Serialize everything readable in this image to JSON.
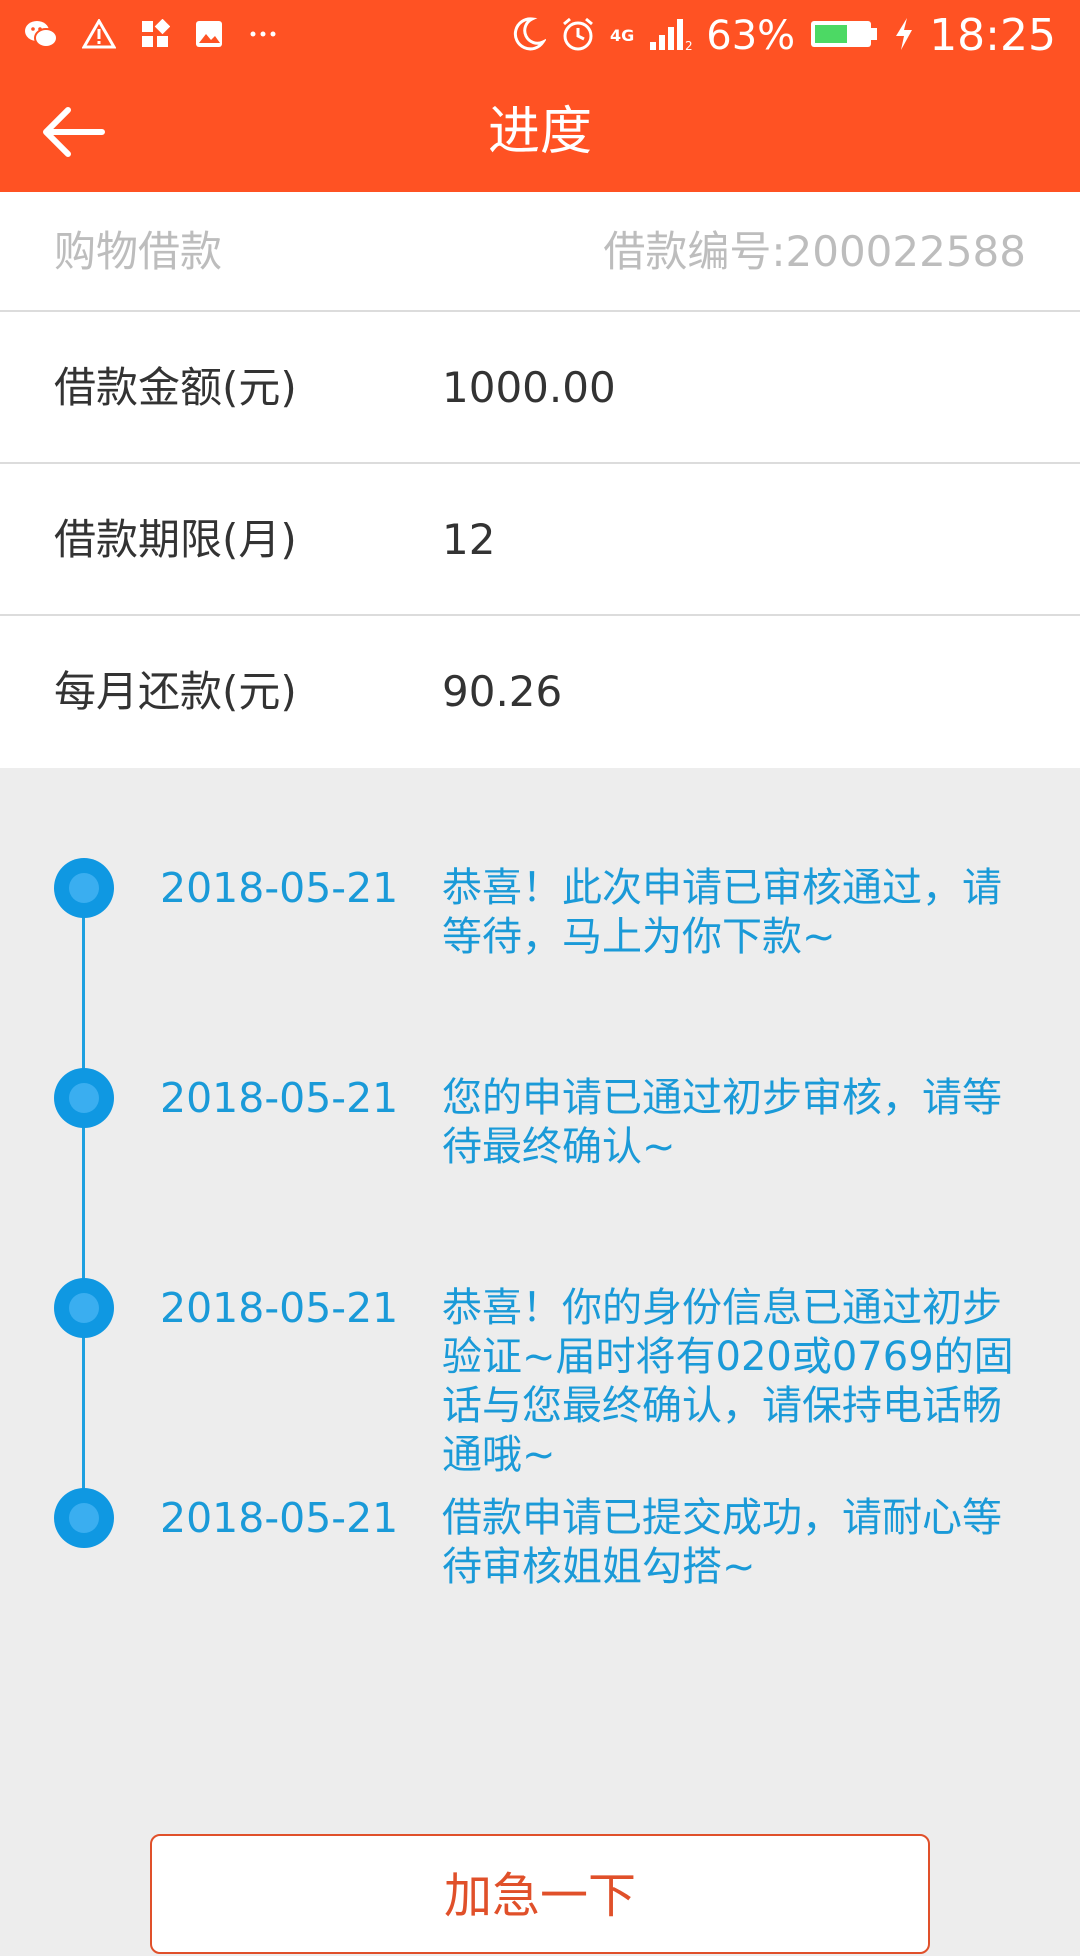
{
  "status_bar": {
    "battery": "63%",
    "time": "18:25",
    "network": "4G",
    "icons": [
      "wechat-icon",
      "warning-icon",
      "app-grid-icon",
      "image-icon",
      "more-dots-icon",
      "moon-icon",
      "alarm-icon",
      "signal-icon",
      "battery-icon",
      "charging-icon"
    ]
  },
  "app_bar": {
    "title": "进度",
    "back_icon": "arrow-left-icon"
  },
  "loan": {
    "type": "购物借款",
    "number": "借款编号:200022588",
    "rows": [
      {
        "label": "借款金额(元)",
        "value": "1000.00"
      },
      {
        "label": "借款期限(月)",
        "value": "12"
      },
      {
        "label": "每月还款(元)",
        "value": "90.26"
      }
    ]
  },
  "timeline": [
    {
      "date": "2018-05-21",
      "text": "恭喜！此次申请已审核通过，请等待，马上为你下款~"
    },
    {
      "date": "2018-05-21",
      "text": "您的申请已通过初步审核，请等待最终确认~"
    },
    {
      "date": "2018-05-21",
      "text": "恭喜！你的身份信息已通过初步验证~届时将有020或0769的固话与您最终确认，请保持电话畅通哦~"
    },
    {
      "date": "2018-05-21",
      "text": "借款申请已提交成功，请耐心等待审核姐姐勾搭~"
    }
  ],
  "urgent_button": "加急一下",
  "colors": {
    "brand": "#ff5223",
    "timeline": "#1a9ad8",
    "button_text": "#e0502a",
    "background": "#ededed"
  }
}
